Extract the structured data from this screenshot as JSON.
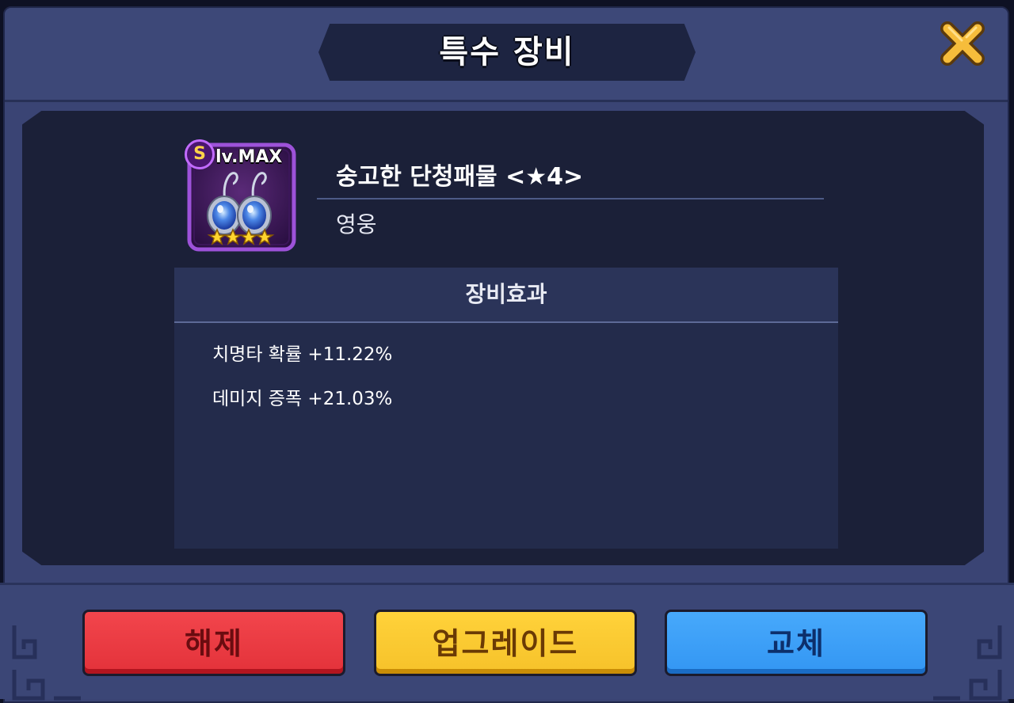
{
  "dialog": {
    "title": "특수 장비",
    "close_icon": "close-x-icon"
  },
  "item": {
    "grade": "S",
    "level": "lv.MAX",
    "stars": 4,
    "name": "숭고한 단청패물 <★4>",
    "rarity": "영웅",
    "icon": "earrings-icon"
  },
  "effects": {
    "header": "장비효과",
    "lines": [
      "치명타 확률 +11.22%",
      "데미지 증폭 +21.03%"
    ]
  },
  "buttons": {
    "unequip": "해제",
    "upgrade": "업그레이드",
    "replace": "교체"
  },
  "colors": {
    "red_button": "#f03c44",
    "yellow_button": "#fbca31",
    "blue_button": "#3ba0f7",
    "item_frame": "#6a2b9f"
  }
}
